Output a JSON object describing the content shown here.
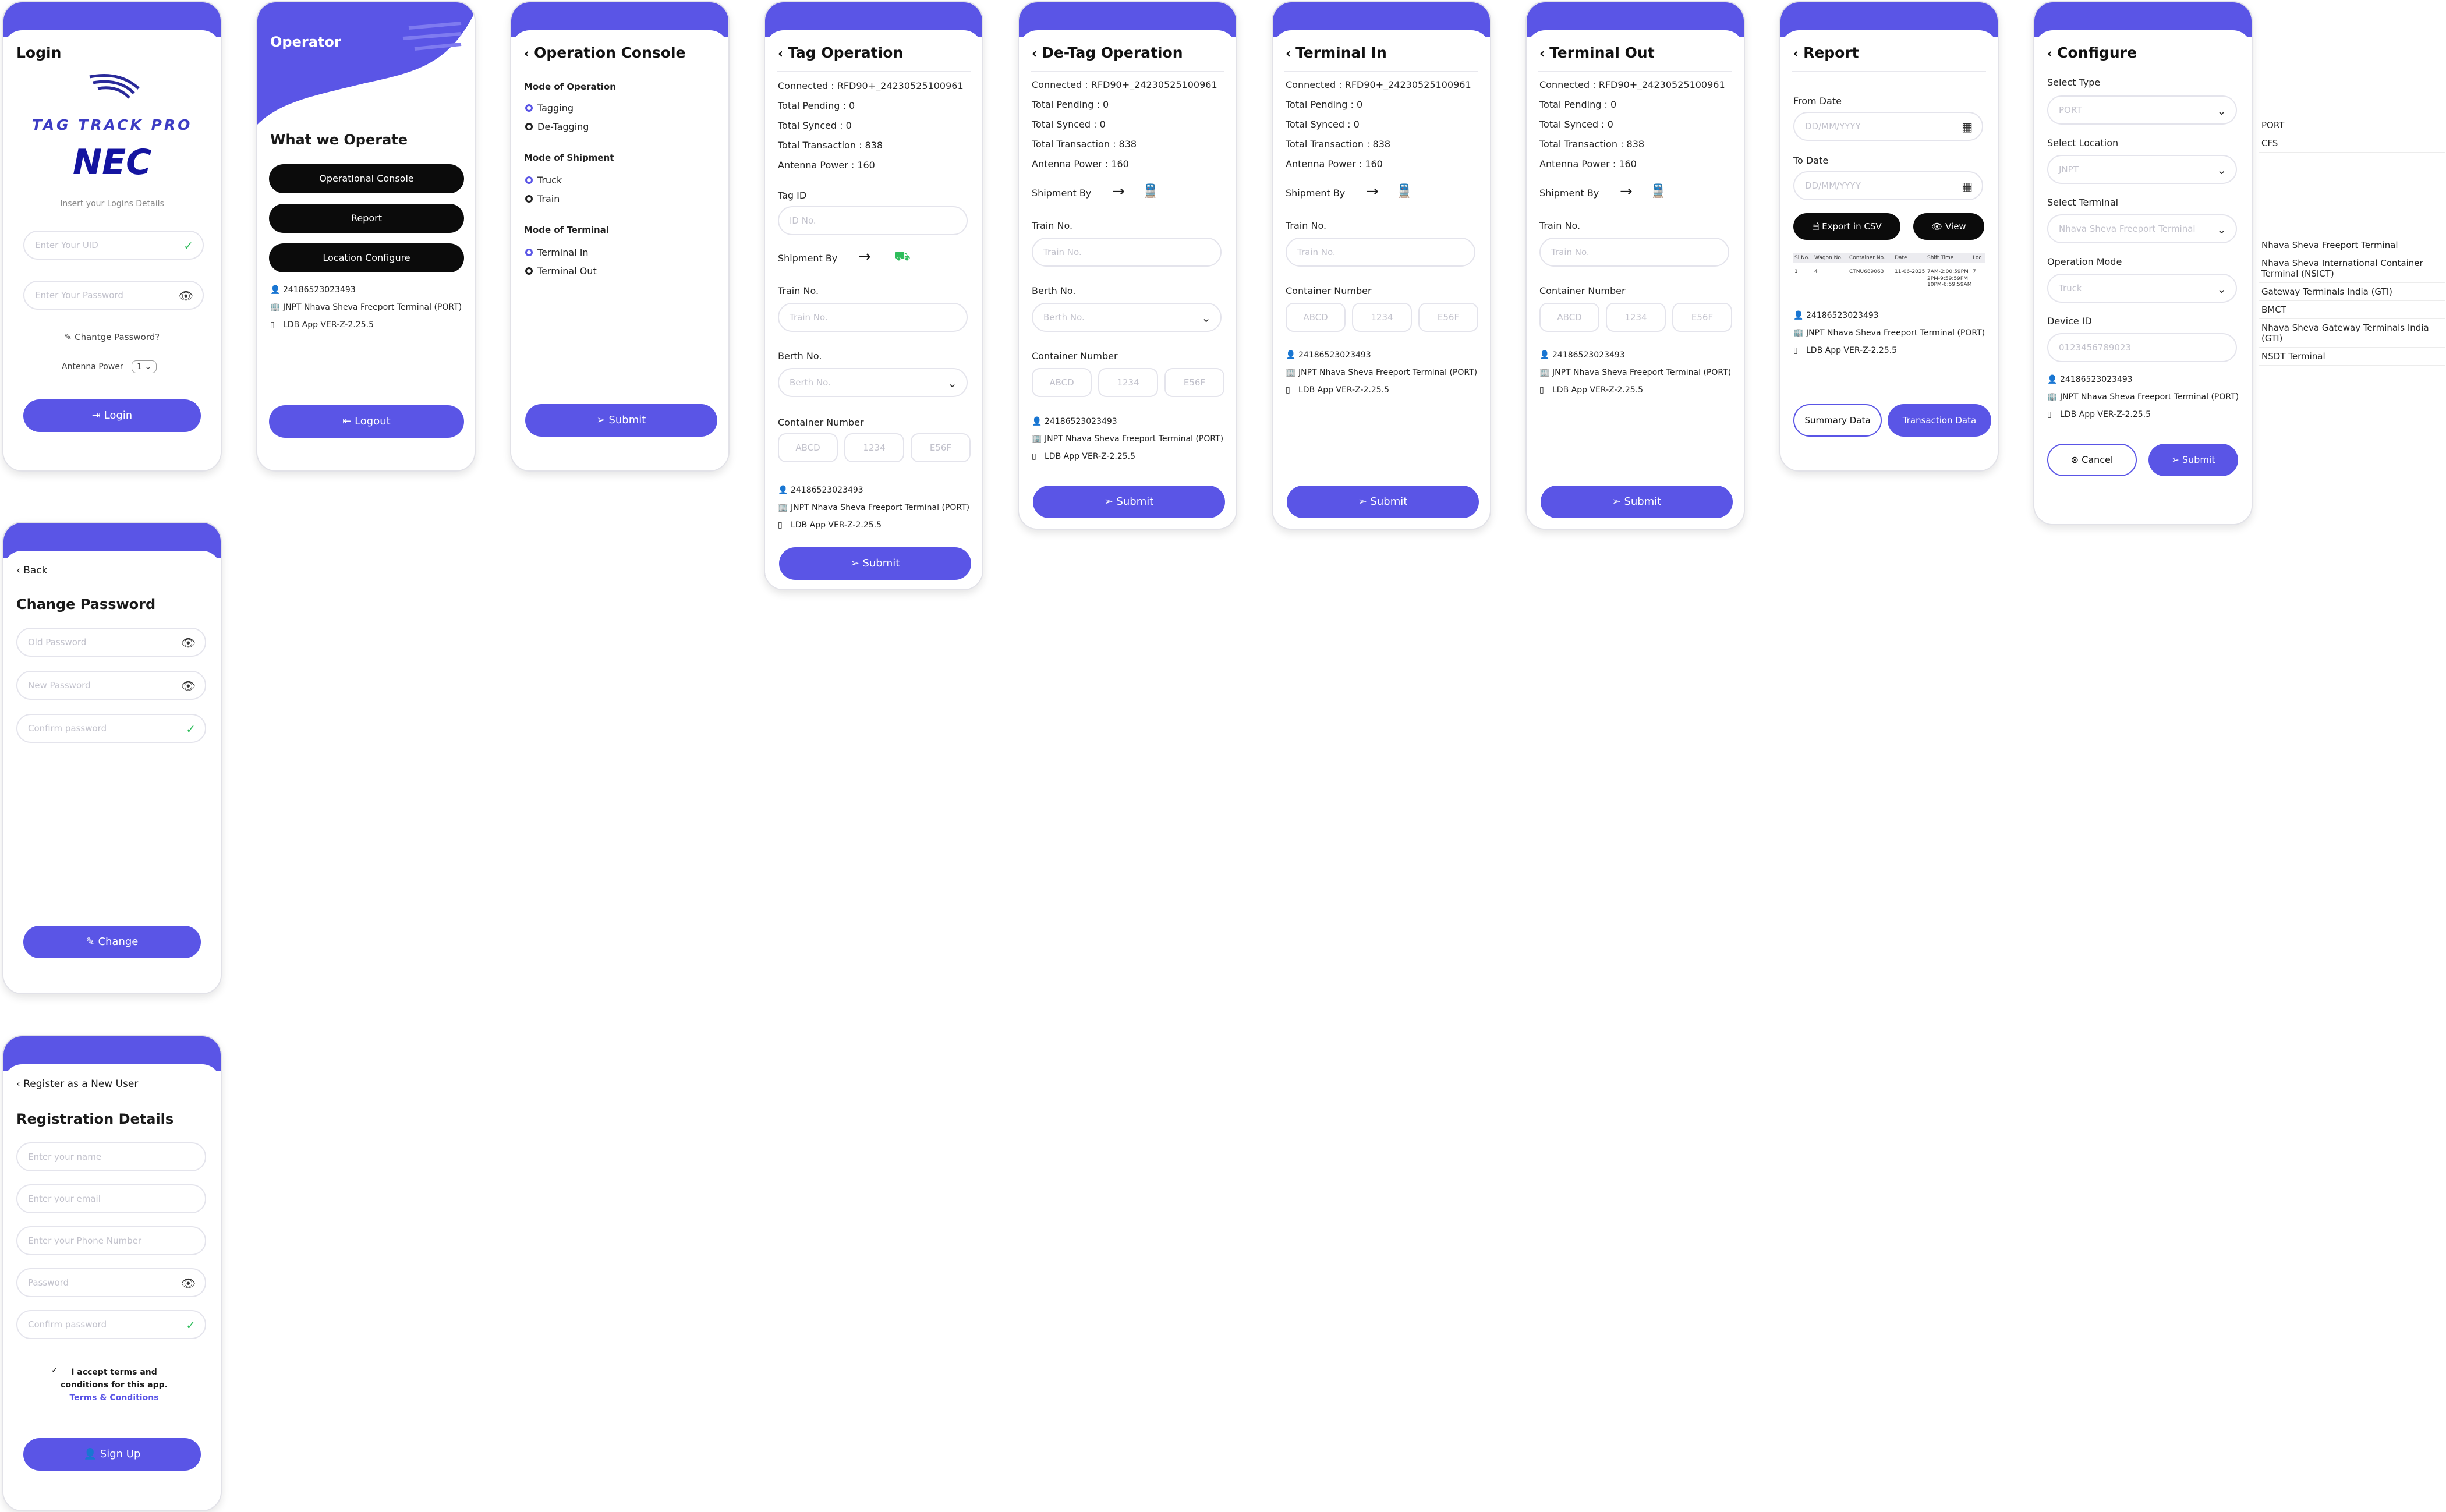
{
  "brand": {
    "app_name": "TAG TRACK PRO",
    "company": "NEC"
  },
  "footer": {
    "user_id": "24186523023493",
    "terminal": "JNPT Nhava Sheva Freeport Terminal (PORT)",
    "version": "LDB App VER-Z-2.25.5"
  },
  "login": {
    "title": "Login",
    "subtitle": "Insert your Logins Details",
    "uid_placeholder": "Enter Your UID",
    "password_placeholder": "Enter Your Password",
    "change_password": "Chantge Password?",
    "antenna_label": "Antenna Power",
    "antenna_value": "1",
    "login_button": "Login"
  },
  "operator": {
    "title": "Operator",
    "subtitle": "What we Operate",
    "buttons": [
      "Operational Console",
      "Report",
      "Location Configure"
    ],
    "logout": "Logout"
  },
  "console": {
    "title": "Operation Console",
    "sections": [
      {
        "heading": "Mode of Operation",
        "options": [
          "Tagging",
          "De-Tagging"
        ]
      },
      {
        "heading": "Mode of Shipment",
        "options": [
          "Truck",
          "Train"
        ]
      },
      {
        "heading": "Mode of Terminal",
        "options": [
          "Terminal In",
          "Terminal Out"
        ]
      }
    ],
    "submit": "Submit"
  },
  "status": {
    "connected": "Connected : RFD90+_24230525100961",
    "pending": "Total Pending : 0",
    "synced": "Total Synced : 0",
    "transaction": "Total Transaction : 838",
    "antenna": "Antenna Power : 160"
  },
  "tag": {
    "title": "Tag Operation",
    "tag_label": "Tag ID",
    "tag_placeholder": "ID No.",
    "shipment_label": "Shipment By",
    "train_label": "Train No.",
    "train_placeholder": "Train No.",
    "berth_label": "Berth No.",
    "berth_placeholder": "Berth No.",
    "container_label": "Container Number",
    "container_parts": [
      "ABCD",
      "1234",
      "E56F"
    ],
    "submit": "Submit"
  },
  "detag": {
    "title": "De-Tag Operation"
  },
  "term_in": {
    "title": "Terminal In"
  },
  "term_out": {
    "title": "Terminal Out"
  },
  "report": {
    "title": "Report",
    "from_label": "From Date",
    "to_label": "To Date",
    "date_placeholder": "DD/MM/YYYY",
    "export": "Export in CSV",
    "view": "View",
    "table_headers": [
      "Sl No.",
      "Wagon No.",
      "Container No.",
      "Date",
      "Shift Time",
      "Loc"
    ],
    "table_row": [
      "1",
      "4",
      "CTNU689063",
      "11-06-2025",
      "7AM-2:00:59PM",
      "7"
    ],
    "table_extra": [
      "2PM-9:59:59PM",
      "10PM-6:59:59AM"
    ],
    "summary": "Summary Data",
    "transaction": "Transaction Data"
  },
  "configure": {
    "title": "Configure",
    "type_label": "Select Type",
    "type_value": "PORT",
    "location_label": "Select Location",
    "location_value": "JNPT",
    "terminal_label": "Select Terminal",
    "terminal_value": "Nhava Sheva Freeport Terminal",
    "mode_label": "Operation Mode",
    "mode_value": "Truck",
    "device_label": "Device ID",
    "device_value": "0123456789023",
    "cancel": "Cancel",
    "submit": "Submit"
  },
  "dropdowns": {
    "types": [
      "PORT",
      "CFS"
    ],
    "terminals": [
      "Nhava Sheva Freeport Terminal",
      "Nhava Sheva International Container Terminal (NSICT)",
      "Gateway Terminals India (GTI)",
      "BMCT",
      "Nhava Sheva Gateway Terminals India (GTI)",
      "NSDT Terminal"
    ]
  },
  "change_pw": {
    "back": "Back",
    "title": "Change Password",
    "old": "Old Password",
    "new": "New Password",
    "confirm": "Confirm password",
    "button": "Change"
  },
  "register": {
    "back": "Register as a New User",
    "title": "Registration Details",
    "name": "Enter your name",
    "email": "Enter your email",
    "phone": "Enter your Phone Number",
    "password": "Password",
    "confirm": "Confirm password",
    "terms_line1": "I accept terms and",
    "terms_line2": "conditions for this app.",
    "terms_link": "Terms & Conditions",
    "button": "Sign Up"
  },
  "colors": {
    "accent": "#5a55e6",
    "success": "#2ebd5b",
    "dark": "#0b0b0b"
  }
}
